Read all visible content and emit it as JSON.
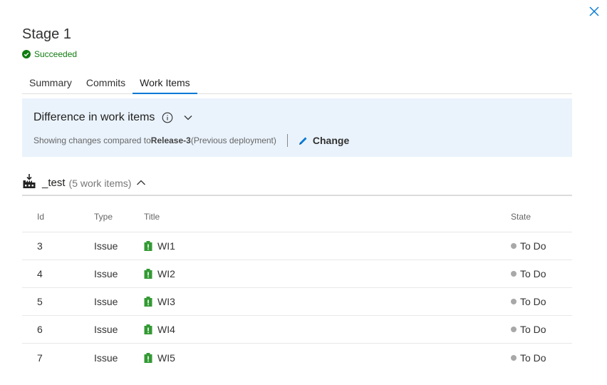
{
  "panel": {
    "title": "Stage 1",
    "status": "Succeeded",
    "status_color": "#107c10"
  },
  "tabs": [
    {
      "label": "Summary",
      "active": false
    },
    {
      "label": "Commits",
      "active": false
    },
    {
      "label": "Work Items",
      "active": true
    }
  ],
  "diff": {
    "title": "Difference in work items",
    "subtitle_prefix": "Showing changes compared to ",
    "release": "Release-3",
    "subtitle_suffix": " (Previous deployment)",
    "change_label": "Change"
  },
  "group": {
    "name": "_test",
    "count_label": "(5 work items)"
  },
  "table": {
    "columns": {
      "id": "Id",
      "type": "Type",
      "title": "Title",
      "state": "State"
    },
    "rows": [
      {
        "id": "3",
        "type": "Issue",
        "title": "WI1",
        "state": "To Do"
      },
      {
        "id": "4",
        "type": "Issue",
        "title": "WI2",
        "state": "To Do"
      },
      {
        "id": "5",
        "type": "Issue",
        "title": "WI3",
        "state": "To Do"
      },
      {
        "id": "6",
        "type": "Issue",
        "title": "WI4",
        "state": "To Do"
      },
      {
        "id": "7",
        "type": "Issue",
        "title": "WI5",
        "state": "To Do"
      }
    ]
  },
  "colors": {
    "accent": "#0078d4",
    "diff_bg": "#eaf3fc",
    "issue_icon": "#339933",
    "state_todo": "#a8a8a8"
  }
}
